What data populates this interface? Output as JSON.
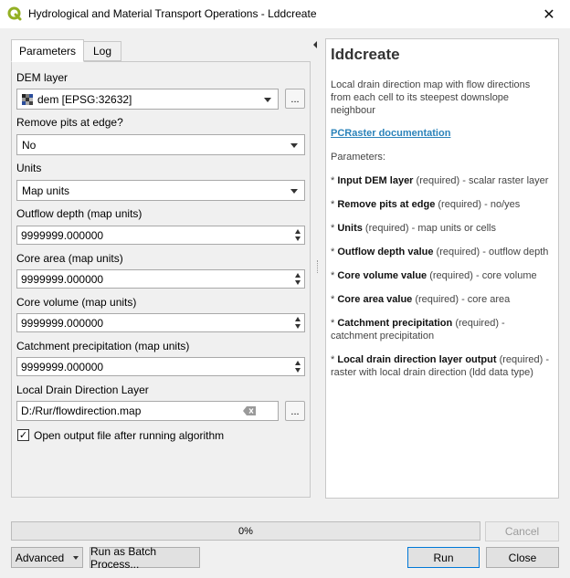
{
  "window": {
    "title": "Hydrological and Material Transport Operations - Lddcreate",
    "close_label": "✕"
  },
  "tabs": [
    {
      "label": "Parameters"
    },
    {
      "label": "Log"
    }
  ],
  "params": {
    "dem_label": "DEM layer",
    "dem_value": "dem [EPSG:32632]",
    "dem_browse": "...",
    "pits_label": "Remove pits at edge?",
    "pits_value": "No",
    "units_label": "Units",
    "units_value": "Map units",
    "outflow_label": "Outflow depth (map units)",
    "outflow_value": "9999999.000000",
    "core_area_label": "Core area (map units)",
    "core_area_value": "9999999.000000",
    "core_volume_label": "Core volume (map units)",
    "core_volume_value": "9999999.000000",
    "precip_label": "Catchment precipitation (map units)",
    "precip_value": "9999999.000000",
    "ldd_label": "Local Drain Direction Layer",
    "ldd_value": "D:/Rur/flowdirection.map",
    "ldd_browse": "...",
    "open_output_label": "Open output file after running algorithm",
    "open_output_checked": true,
    "check_glyph": "✓"
  },
  "help": {
    "title": "lddcreate",
    "description": "Local drain direction map with flow directions from each cell to its steepest downslope neighbour",
    "link": "PCRaster documentation",
    "params_heading": "Parameters:",
    "items": [
      {
        "name": "Input DEM layer",
        "desc": "(required) - scalar raster layer"
      },
      {
        "name": "Remove pits at edge",
        "desc": "(required) - no/yes"
      },
      {
        "name": "Units",
        "desc": "(required) - map units or cells"
      },
      {
        "name": "Outflow depth value",
        "desc": "(required) - outflow depth"
      },
      {
        "name": "Core volume value",
        "desc": "(required) - core volume"
      },
      {
        "name": "Core area value",
        "desc": "(required) - core area"
      },
      {
        "name": "Catchment precipitation",
        "desc": "(required) - catchment precipitation"
      },
      {
        "name": "Local drain direction layer output",
        "desc": "(required) - raster with local drain direction (ldd data type)"
      }
    ]
  },
  "footer": {
    "progress_text": "0%",
    "progress": 0,
    "cancel": "Cancel",
    "advanced": "Advanced",
    "batch": "Run as Batch Process...",
    "run": "Run",
    "close": "Close"
  },
  "colors": {
    "accent": "#0078d7",
    "link": "#2b83ba",
    "qgis_green": "#93b023"
  },
  "icons": {
    "app": "qgis-logo-icon",
    "raster": "raster-layer-icon",
    "clear": "clear-field-icon"
  }
}
